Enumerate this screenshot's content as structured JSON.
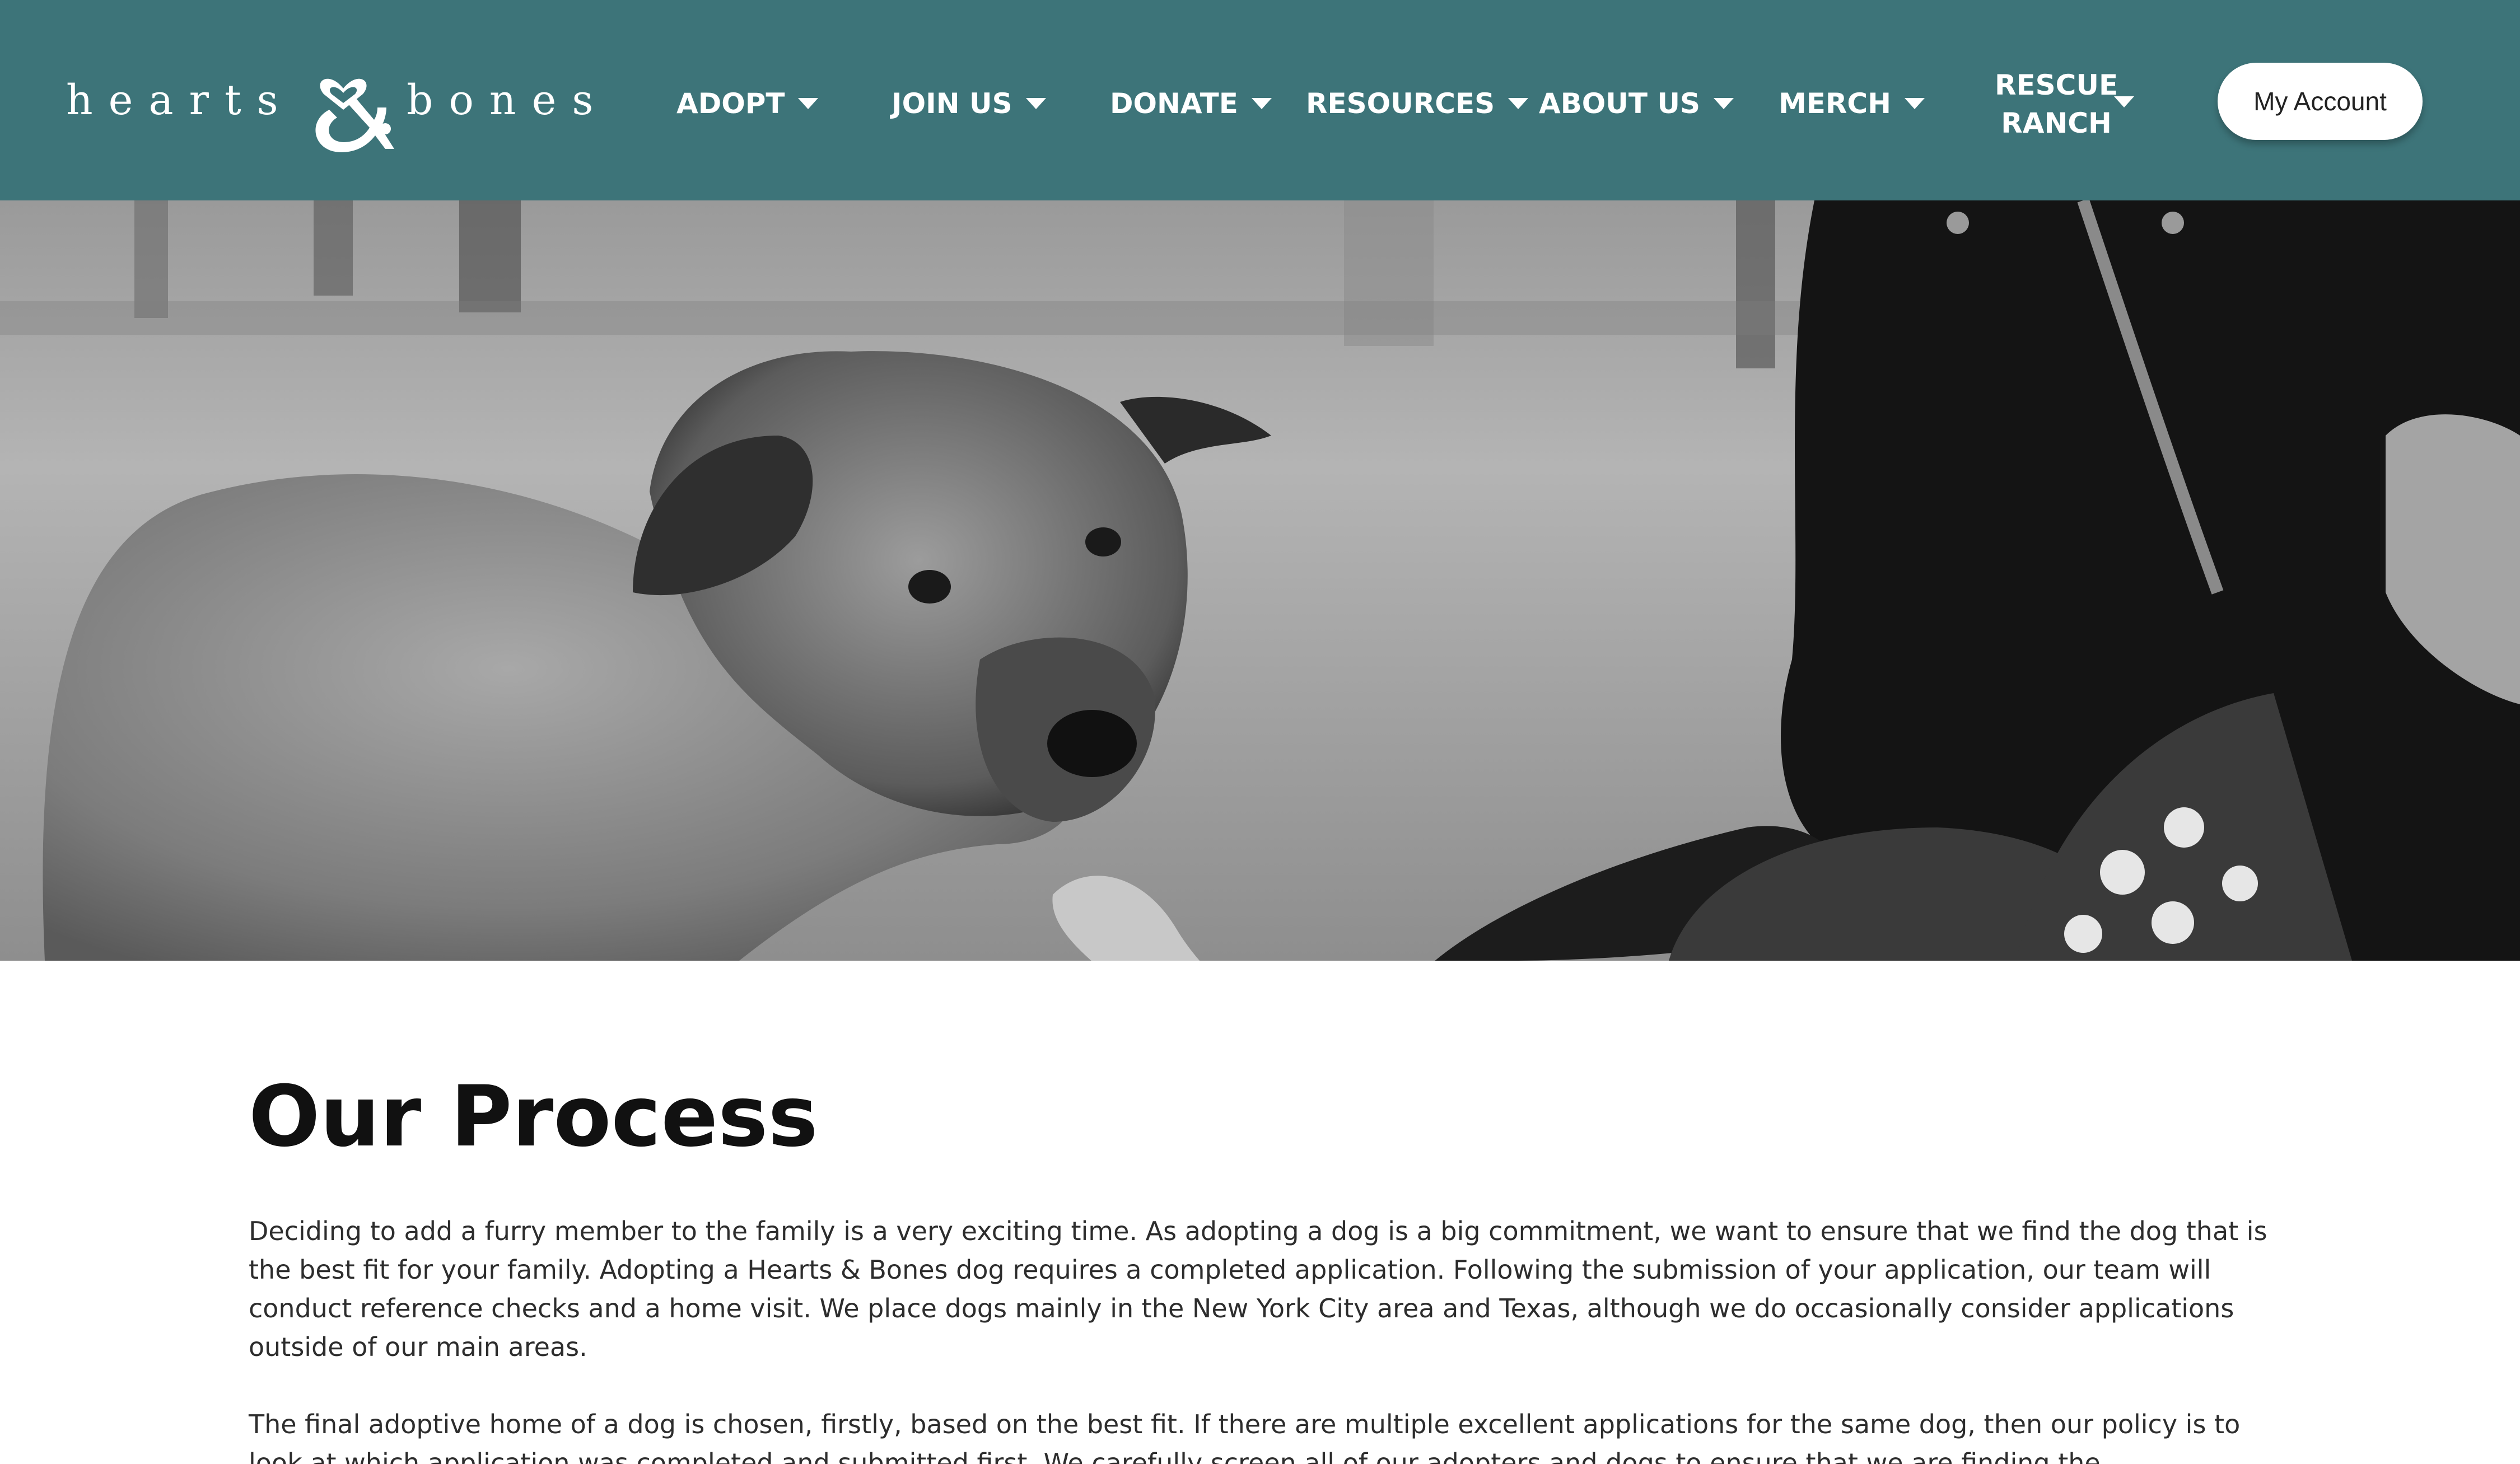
{
  "header": {
    "logo": {
      "word_left": "hearts",
      "ampersand": "&",
      "word_right": "bones"
    },
    "nav": [
      {
        "label": "ADOPT",
        "icon": "chevron-down-icon"
      },
      {
        "label": "JOIN US",
        "icon": "chevron-down-icon"
      },
      {
        "label": "DONATE",
        "icon": "chevron-down-icon"
      },
      {
        "label": "RESOURCES",
        "icon": "chevron-down-icon"
      },
      {
        "label": "ABOUT US",
        "icon": "chevron-down-icon"
      },
      {
        "label": "MERCH",
        "icon": "chevron-down-icon"
      }
    ],
    "nav_rescue": {
      "line1": "RESCUE",
      "line2": "RANCH",
      "icon": "chevron-down-icon"
    },
    "account_button": "My Account"
  },
  "hero": {
    "image": "black-and-white photo of a shepherd-mix dog giving its paw to a person in a dark jacket"
  },
  "main": {
    "title": "Our Process",
    "paragraphs": [
      "Deciding to add a furry member to the family is a very exciting time. As adopting a dog is a big commitment, we want to ensure that we find the dog that is the best fit for your family. Adopting a Hearts & Bones dog requires a completed application. Following the submission of your application, our team will conduct reference checks and a home visit. We place dogs mainly in the New York City area and Texas, although we do occasionally consider applications outside of our main areas.",
      "The final adoptive home of a dog is chosen, firstly, based on the best fit. If there are multiple excellent applications for the same dog, then our policy is to look at which application was completed and submitted first. We carefully screen all of our adopters and dogs to ensure that we are finding the"
    ]
  },
  "colors": {
    "header_bg": "#3d7479",
    "nav_text": "#ffffff",
    "button_bg": "#ffffff",
    "title_text": "#111111",
    "body_text": "#2d2d2d"
  }
}
